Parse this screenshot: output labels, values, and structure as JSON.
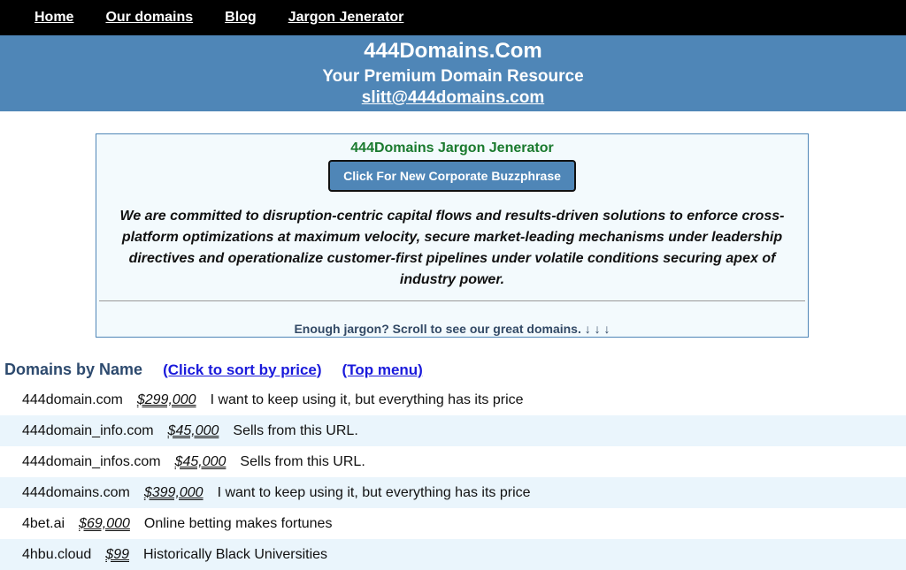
{
  "nav": {
    "items": [
      {
        "label": "Home"
      },
      {
        "label": "Our domains"
      },
      {
        "label": "Blog"
      },
      {
        "label": "Jargon Jenerator"
      }
    ]
  },
  "banner": {
    "title": "444Domains.Com",
    "tagline": "Your Premium Domain Resource",
    "email": "slitt@444domains.com"
  },
  "jargon": {
    "title": "444Domains Jargon Jenerator",
    "button_label": "Click For New Corporate Buzzphrase",
    "text": "We are committed to disruption-centric capital flows and results-driven solutions to enforce cross-platform optimizations at maximum velocity, secure market-leading mechanisms under leadership directives and operationalize customer-first pipelines under volatile conditions securing apex of industry power.",
    "footer": "Enough jargon? Scroll to see our great domains. ↓ ↓ ↓"
  },
  "domains_section": {
    "heading": "Domains by Name",
    "sort_link": "(Click to sort by price)",
    "top_link": "(Top menu)"
  },
  "domains": [
    {
      "name": "444domain.com",
      "price": "$299,000",
      "desc": "I want to keep using it, but everything has its price"
    },
    {
      "name": "444domain_info.com",
      "price": "$45,000",
      "desc": "Sells from this URL."
    },
    {
      "name": "444domain_infos.com",
      "price": "$45,000",
      "desc": "Sells from this URL."
    },
    {
      "name": "444domains.com",
      "price": "$399,000",
      "desc": "I want to keep using it, but everything has its price"
    },
    {
      "name": "4bet.ai",
      "price": "$69,000",
      "desc": "Online betting makes fortunes"
    },
    {
      "name": "4hbu.cloud",
      "price": "$99",
      "desc": "Historically Black Universities"
    }
  ]
}
